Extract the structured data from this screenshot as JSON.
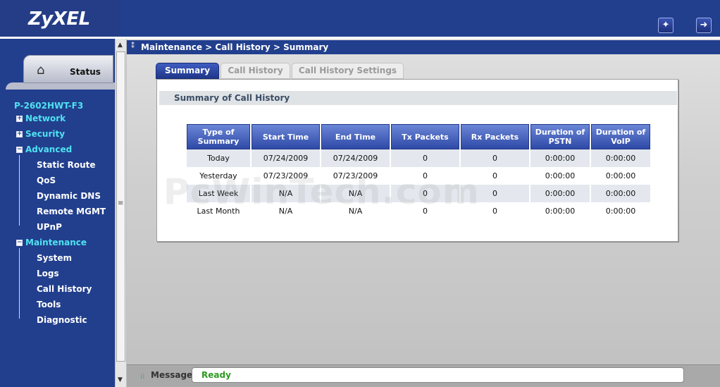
{
  "header": {
    "logo": "ZyXEL",
    "icons": [
      "wizard-icon",
      "logout-icon"
    ]
  },
  "sidebar": {
    "status_label": "Status",
    "model": "P-2602HWT-F3",
    "items": [
      {
        "label": "Network",
        "expander": "+"
      },
      {
        "label": "Security",
        "expander": "+"
      },
      {
        "label": "Advanced",
        "expander": "-"
      },
      {
        "label": "Static Route"
      },
      {
        "label": "QoS"
      },
      {
        "label": "Dynamic DNS"
      },
      {
        "label": "Remote MGMT"
      },
      {
        "label": "UPnP"
      },
      {
        "label": "Maintenance",
        "expander": "-"
      },
      {
        "label": "System"
      },
      {
        "label": "Logs"
      },
      {
        "label": "Call History"
      },
      {
        "label": "Tools"
      },
      {
        "label": "Diagnostic"
      }
    ]
  },
  "breadcrumb": "Maintenance > Call History > Summary",
  "tabs": [
    {
      "label": "Summary",
      "active": true
    },
    {
      "label": "Call History",
      "active": false
    },
    {
      "label": "Call History Settings",
      "active": false
    }
  ],
  "panel": {
    "title": "Summary of Call History",
    "headers": [
      "Type of Summary",
      "Start Time",
      "End Time",
      "Tx Packets",
      "Rx Packets",
      "Duration of PSTN",
      "Duration of VoIP"
    ],
    "rows": [
      [
        "Today",
        "07/24/2009",
        "07/24/2009",
        "0",
        "0",
        "0:00:00",
        "0:00:00"
      ],
      [
        "Yesterday",
        "07/23/2009",
        "07/23/2009",
        "0",
        "0",
        "0:00:00",
        "0:00:00"
      ],
      [
        "Last Week",
        "N/A",
        "N/A",
        "0",
        "0",
        "0:00:00",
        "0:00:00"
      ],
      [
        "Last Month",
        "N/A",
        "N/A",
        "0",
        "0",
        "0:00:00",
        "0:00:00"
      ]
    ]
  },
  "watermark": "PcWinTech.com",
  "statusbar": {
    "label": "Message",
    "value": "Ready"
  },
  "colors": {
    "brand_blue": "#223f8e",
    "accent_cyan": "#4fe2f0",
    "ready_green": "#2c9a20"
  }
}
